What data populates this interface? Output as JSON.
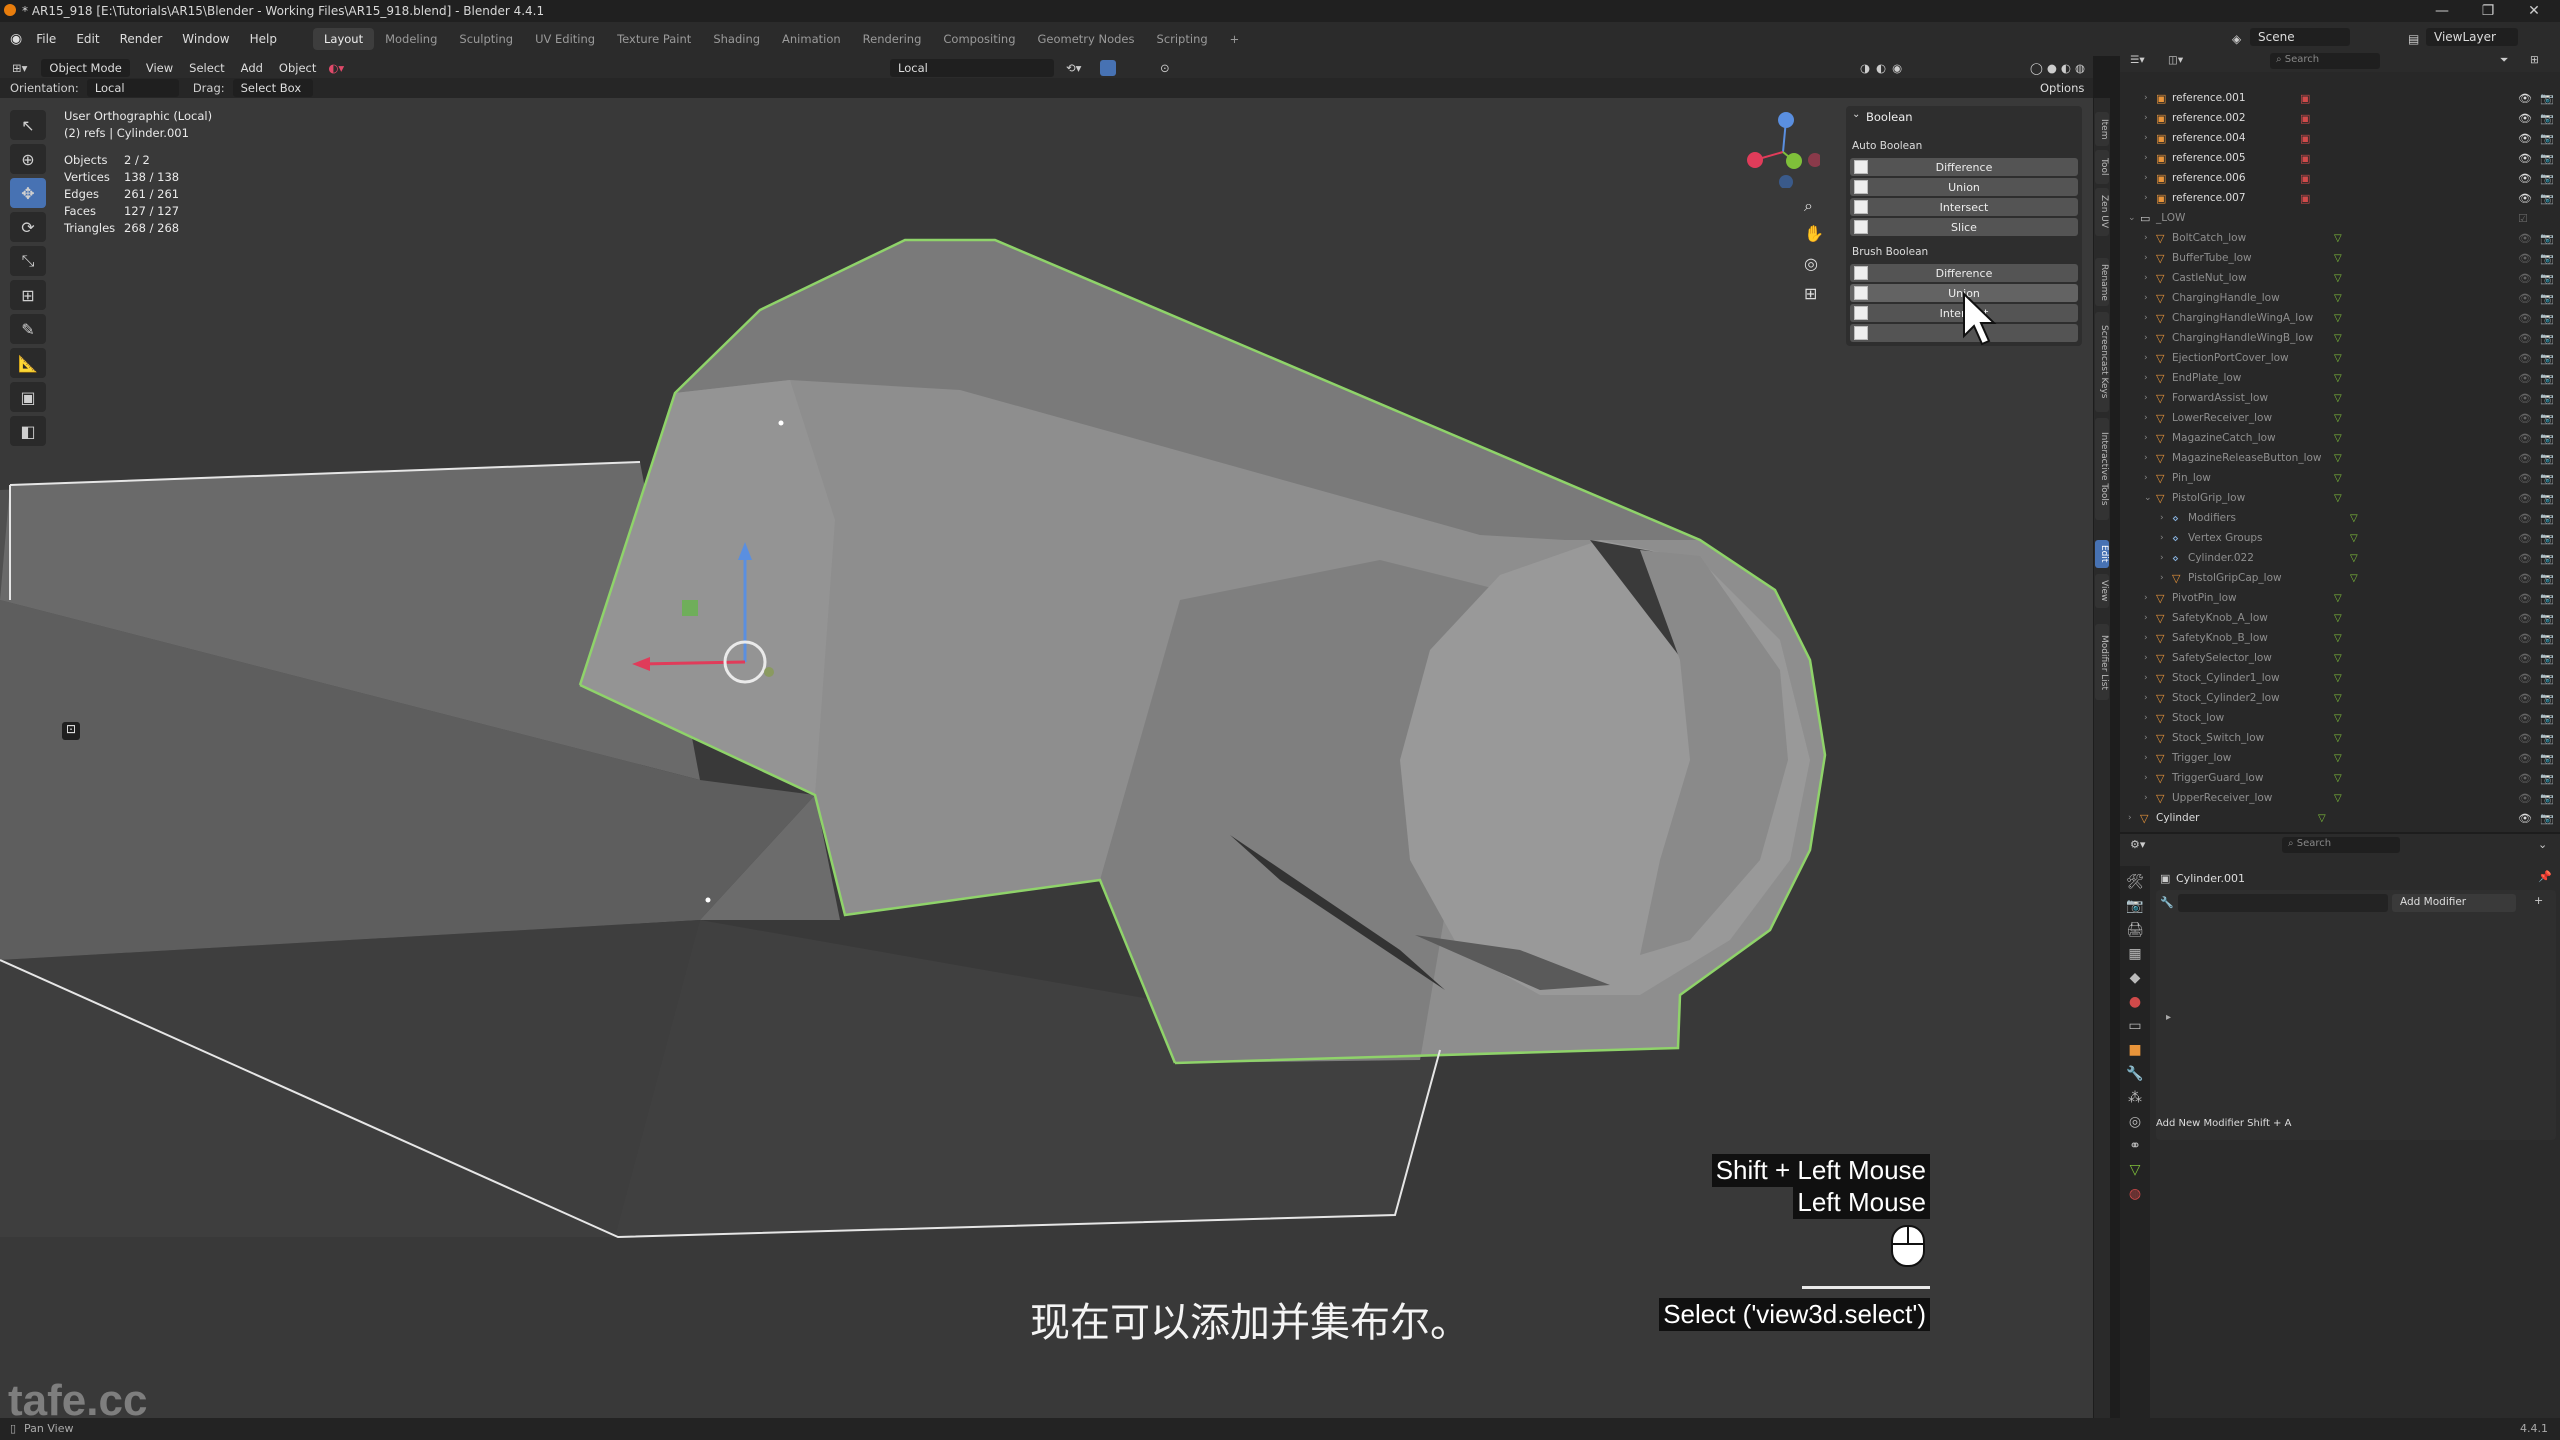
{
  "window": {
    "title": "* AR15_918 [E:\\Tutorials\\AR15\\Blender - Working Files\\AR15_918.blend] - Blender 4.4.1",
    "controls": [
      "—",
      "❐",
      "✕"
    ]
  },
  "menubar": {
    "menus": [
      "File",
      "Edit",
      "Render",
      "Window",
      "Help"
    ],
    "workspaces": [
      "Layout",
      "Modeling",
      "Sculpting",
      "UV Editing",
      "Texture Paint",
      "Shading",
      "Animation",
      "Rendering",
      "Compositing",
      "Geometry Nodes",
      "Scripting"
    ],
    "active_workspace": "Layout",
    "add_tab": "+",
    "scene_label": "Scene",
    "viewlayer_label": "ViewLayer"
  },
  "viewport_header": {
    "mode": "Object Mode",
    "menus": [
      "View",
      "Select",
      "Add",
      "Object"
    ],
    "transform_orientation": "Local",
    "options": "Options"
  },
  "tool_settings": {
    "orientation_label": "Orientation:",
    "orientation_value": "Local",
    "drag_label": "Drag:",
    "drag_value": "Select Box"
  },
  "overlay_stats": {
    "view_name": "User Orthographic (Local)",
    "collection": "(2) refs | Cylinder.001",
    "rows": [
      {
        "label": "Objects",
        "value": "2 / 2"
      },
      {
        "label": "Vertices",
        "value": "138 / 138"
      },
      {
        "label": "Edges",
        "value": "261 / 261"
      },
      {
        "label": "Faces",
        "value": "127 / 127"
      },
      {
        "label": "Triangles",
        "value": "268 / 268"
      }
    ]
  },
  "boolean_panel": {
    "title": "Boolean",
    "auto_section": "Auto Boolean",
    "auto_buttons": [
      "Difference",
      "Union",
      "Intersect",
      "Slice"
    ],
    "brush_section": "Brush Boolean",
    "brush_buttons": [
      "Difference",
      "Union",
      "Intersect",
      ""
    ]
  },
  "side_tabs": [
    "Item",
    "Tool",
    "Zen UV",
    "Rename",
    "Screencast Keys",
    "Interactive Tools",
    "Edit",
    "View",
    "Modifier List"
  ],
  "active_side_tab": "Edit",
  "outliner": {
    "search_placeholder": "Search",
    "rows": [
      {
        "name": "reference.001",
        "indent": 1,
        "type": "ref"
      },
      {
        "name": "reference.002",
        "indent": 1,
        "type": "ref"
      },
      {
        "name": "reference.004",
        "indent": 1,
        "type": "ref"
      },
      {
        "name": "reference.005",
        "indent": 1,
        "type": "ref"
      },
      {
        "name": "reference.006",
        "indent": 1,
        "type": "ref"
      },
      {
        "name": "reference.007",
        "indent": 1,
        "type": "ref"
      },
      {
        "name": "_LOW",
        "indent": 0,
        "type": "collection"
      },
      {
        "name": "BoltCatch_low",
        "indent": 1,
        "type": "mesh"
      },
      {
        "name": "BufferTube_low",
        "indent": 1,
        "type": "mesh"
      },
      {
        "name": "CastleNut_low",
        "indent": 1,
        "type": "mesh"
      },
      {
        "name": "ChargingHandle_low",
        "indent": 1,
        "type": "mesh"
      },
      {
        "name": "ChargingHandleWingA_low",
        "indent": 1,
        "type": "mesh"
      },
      {
        "name": "ChargingHandleWingB_low",
        "indent": 1,
        "type": "mesh"
      },
      {
        "name": "EjectionPortCover_low",
        "indent": 1,
        "type": "mesh"
      },
      {
        "name": "EndPlate_low",
        "indent": 1,
        "type": "mesh"
      },
      {
        "name": "ForwardAssist_low",
        "indent": 1,
        "type": "mesh"
      },
      {
        "name": "LowerReceiver_low",
        "indent": 1,
        "type": "mesh"
      },
      {
        "name": "MagazineCatch_low",
        "indent": 1,
        "type": "mesh"
      },
      {
        "name": "MagazineReleaseButton_low",
        "indent": 1,
        "type": "mesh"
      },
      {
        "name": "Pin_low",
        "indent": 1,
        "type": "mesh"
      },
      {
        "name": "PistolGrip_low",
        "indent": 1,
        "type": "mesh"
      },
      {
        "name": "Modifiers",
        "indent": 2,
        "type": "sub"
      },
      {
        "name": "Vertex Groups",
        "indent": 2,
        "type": "sub"
      },
      {
        "name": "Cylinder.022",
        "indent": 2,
        "type": "sub"
      },
      {
        "name": "PistolGripCap_low",
        "indent": 2,
        "type": "mesh"
      },
      {
        "name": "PivotPin_low",
        "indent": 1,
        "type": "mesh"
      },
      {
        "name": "SafetyKnob_A_low",
        "indent": 1,
        "type": "mesh"
      },
      {
        "name": "SafetyKnob_B_low",
        "indent": 1,
        "type": "mesh"
      },
      {
        "name": "SafetySelector_low",
        "indent": 1,
        "type": "mesh"
      },
      {
        "name": "Stock_Cylinder1_low",
        "indent": 1,
        "type": "mesh"
      },
      {
        "name": "Stock_Cylinder2_low",
        "indent": 1,
        "type": "mesh"
      },
      {
        "name": "Stock_low",
        "indent": 1,
        "type": "mesh"
      },
      {
        "name": "Stock_Switch_low",
        "indent": 1,
        "type": "mesh"
      },
      {
        "name": "Trigger_low",
        "indent": 1,
        "type": "mesh"
      },
      {
        "name": "TriggerGuard_low",
        "indent": 1,
        "type": "mesh"
      },
      {
        "name": "UpperReceiver_low",
        "indent": 1,
        "type": "mesh"
      },
      {
        "name": "Cylinder",
        "indent": 0,
        "type": "mesh"
      }
    ]
  },
  "properties": {
    "search_placeholder": "Search",
    "object_name": "Cylinder.001",
    "add_modifier": "Add Modifier",
    "hint": "Add New Modifier Shift + A"
  },
  "key_overlay": {
    "line1": "Shift + Left Mouse",
    "line2": "Left Mouse",
    "operator": "Select ('view3d.select')"
  },
  "subtitle": "现在可以添加并集布尔。",
  "watermark": "tafe.cc",
  "statusbar": {
    "left": "Pan View",
    "version": "4.4.1"
  },
  "colors": {
    "accent": "#4772b3",
    "selection_outline": "#8fd36a",
    "viewport_bg": "#393939"
  }
}
